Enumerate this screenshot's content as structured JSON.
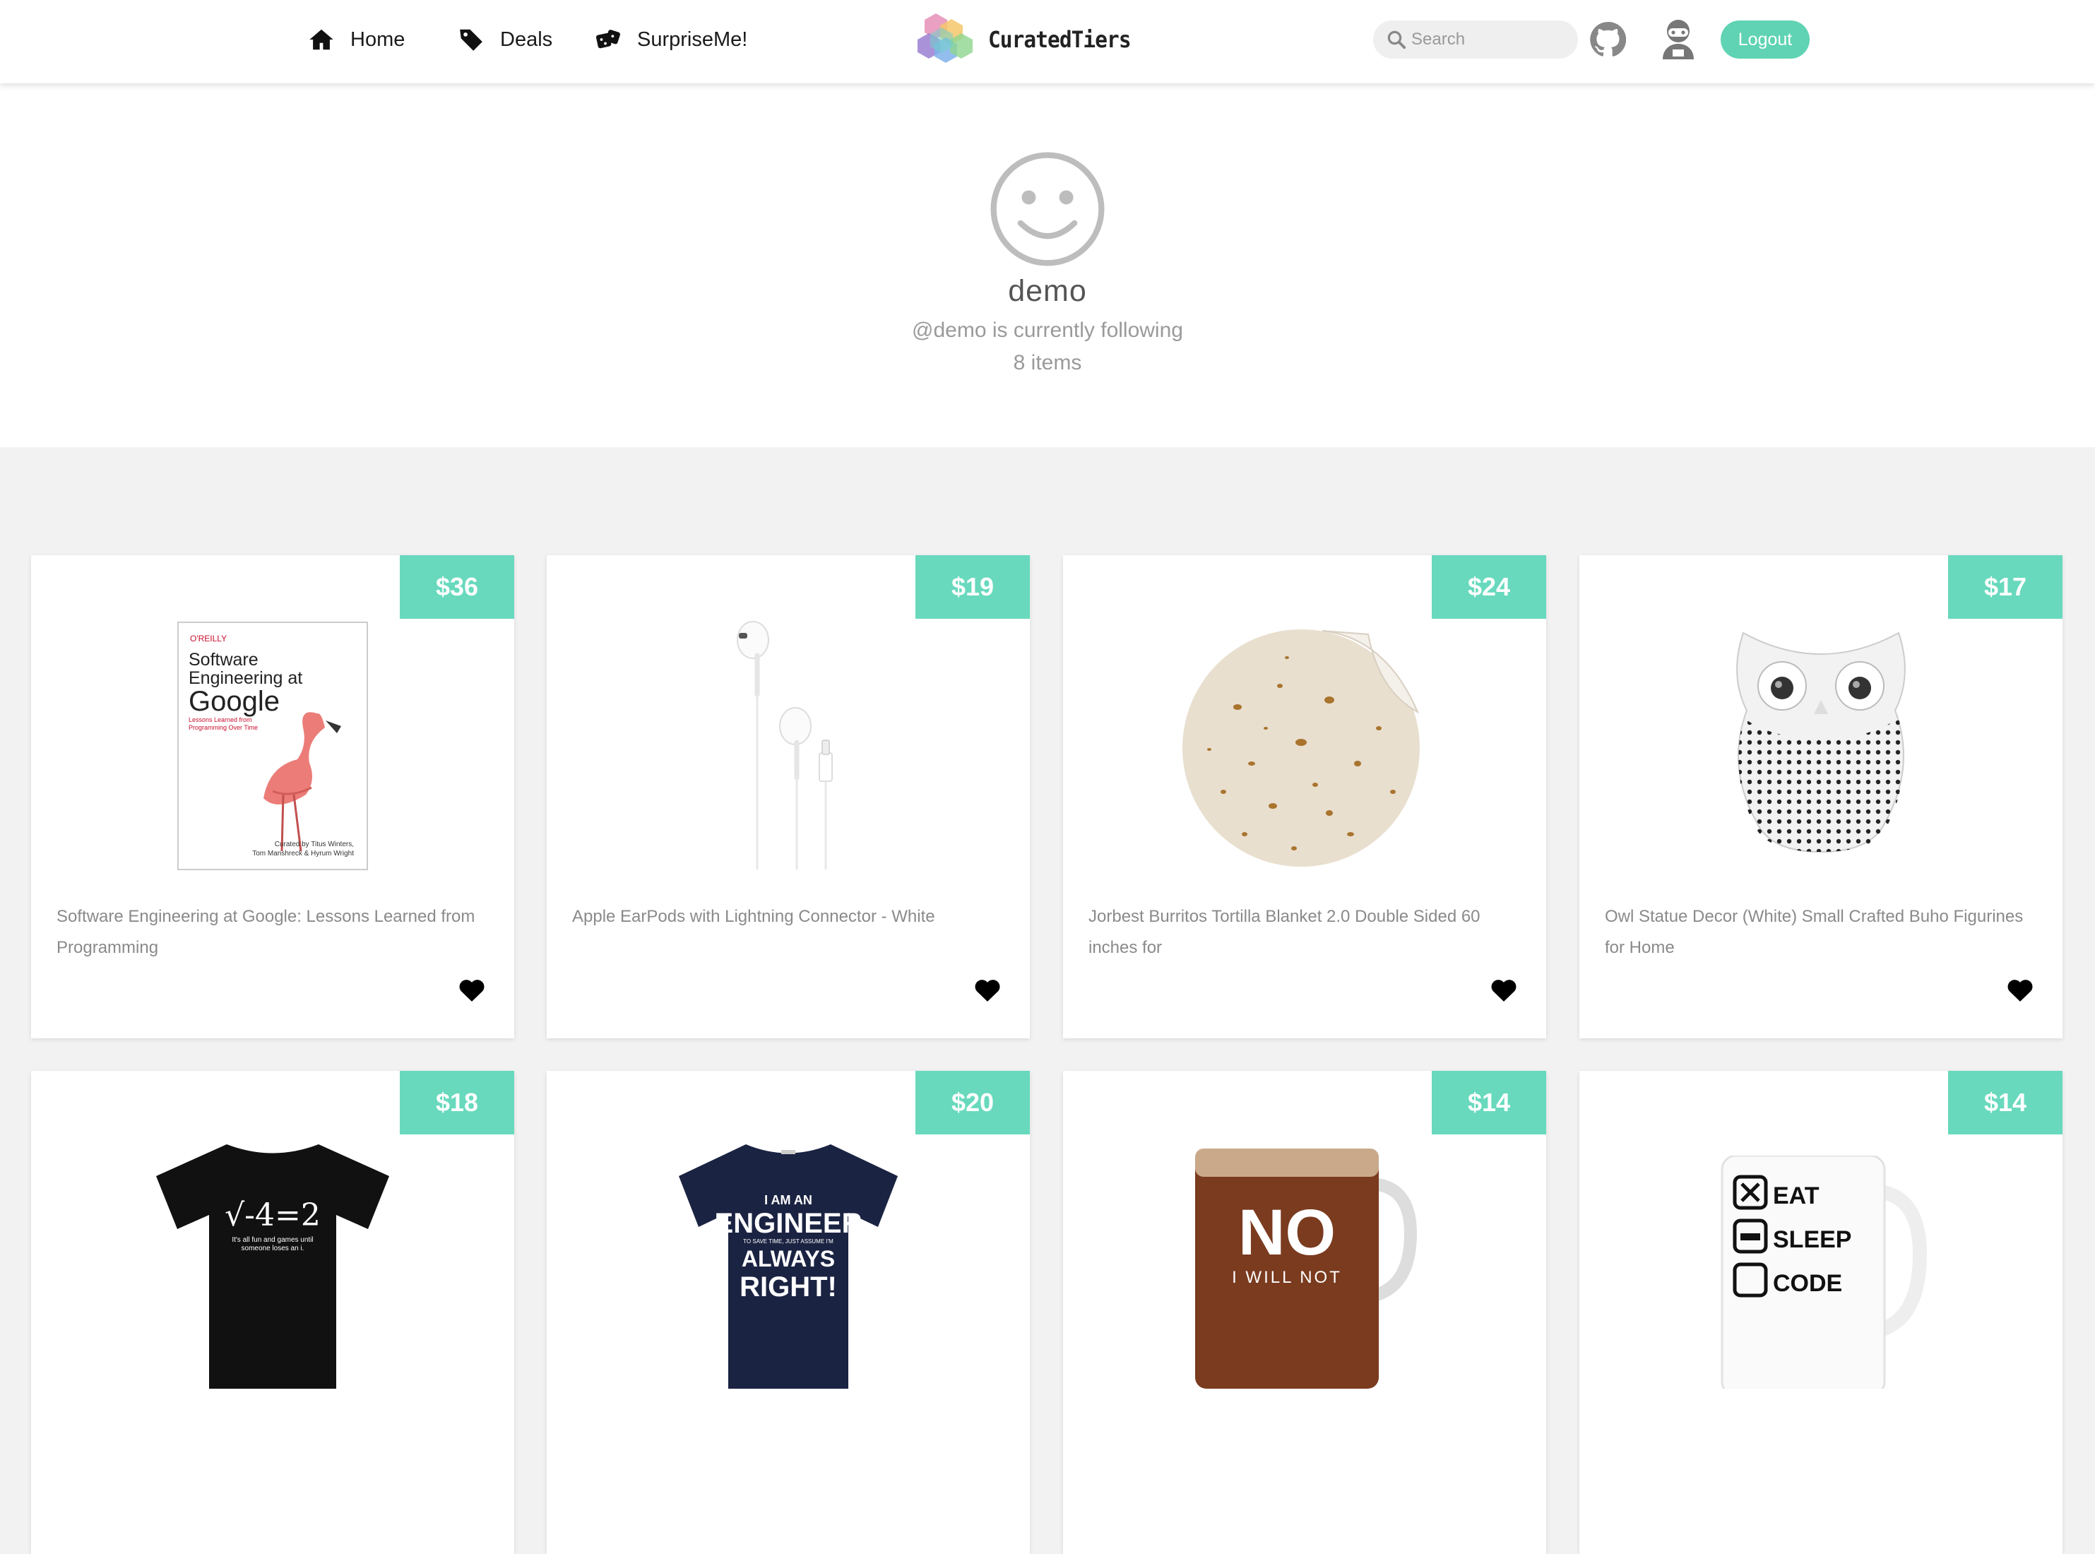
{
  "nav": {
    "home_label": "Home",
    "deals_label": "Deals",
    "surprise_label": "SurpriseMe!",
    "brand": "CuratedTiers",
    "search_placeholder": "Search",
    "logout_label": "Logout"
  },
  "profile": {
    "username": "demo",
    "following_text": "@demo is currently following 8 items"
  },
  "colors": {
    "accent": "#68d9bd",
    "logout": "#5fd3b3"
  },
  "products": [
    {
      "price": "$36",
      "title": "Software Engineering at Google: Lessons Learned from Programming",
      "image": "book-cover",
      "book": {
        "publisher": "O'REILLY",
        "line1": "Software",
        "line2": "Engineering at",
        "line3": "Google",
        "subtitle": "Lessons Learned from Programming Over Time",
        "credit1": "Curated by Titus Winters,",
        "credit2": "Tom Manshreck & Hyrum Wright"
      }
    },
    {
      "price": "$19",
      "title": "Apple EarPods with Lightning Connector - White",
      "image": "earpods"
    },
    {
      "price": "$24",
      "title": "Jorbest Burritos Tortilla Blanket 2.0 Double Sided 60 inches for",
      "image": "tortilla-blanket"
    },
    {
      "price": "$17",
      "title": "Owl Statue Decor (White) Small Crafted Buho Figurines for Home",
      "image": "owl-statue"
    },
    {
      "price": "$18",
      "title": "",
      "image": "math-tshirt",
      "shirt_text": "√-4=2",
      "shirt_sub": "It's all fun and games until someone loses an i."
    },
    {
      "price": "$20",
      "title": "",
      "image": "engineer-tshirt",
      "shirt_lines": [
        "I AM AN",
        "ENGINEER",
        "TO SAVE TIME, JUST ASSUME I'M",
        "ALWAYS",
        "RIGHT!"
      ]
    },
    {
      "price": "$14",
      "title": "",
      "image": "no-mug",
      "mug_big": "NO",
      "mug_small": "I WILL NOT"
    },
    {
      "price": "$14",
      "title": "",
      "image": "eat-sleep-mug",
      "mug_lines": [
        "EAT",
        "SLEEP",
        "CODE"
      ]
    }
  ]
}
